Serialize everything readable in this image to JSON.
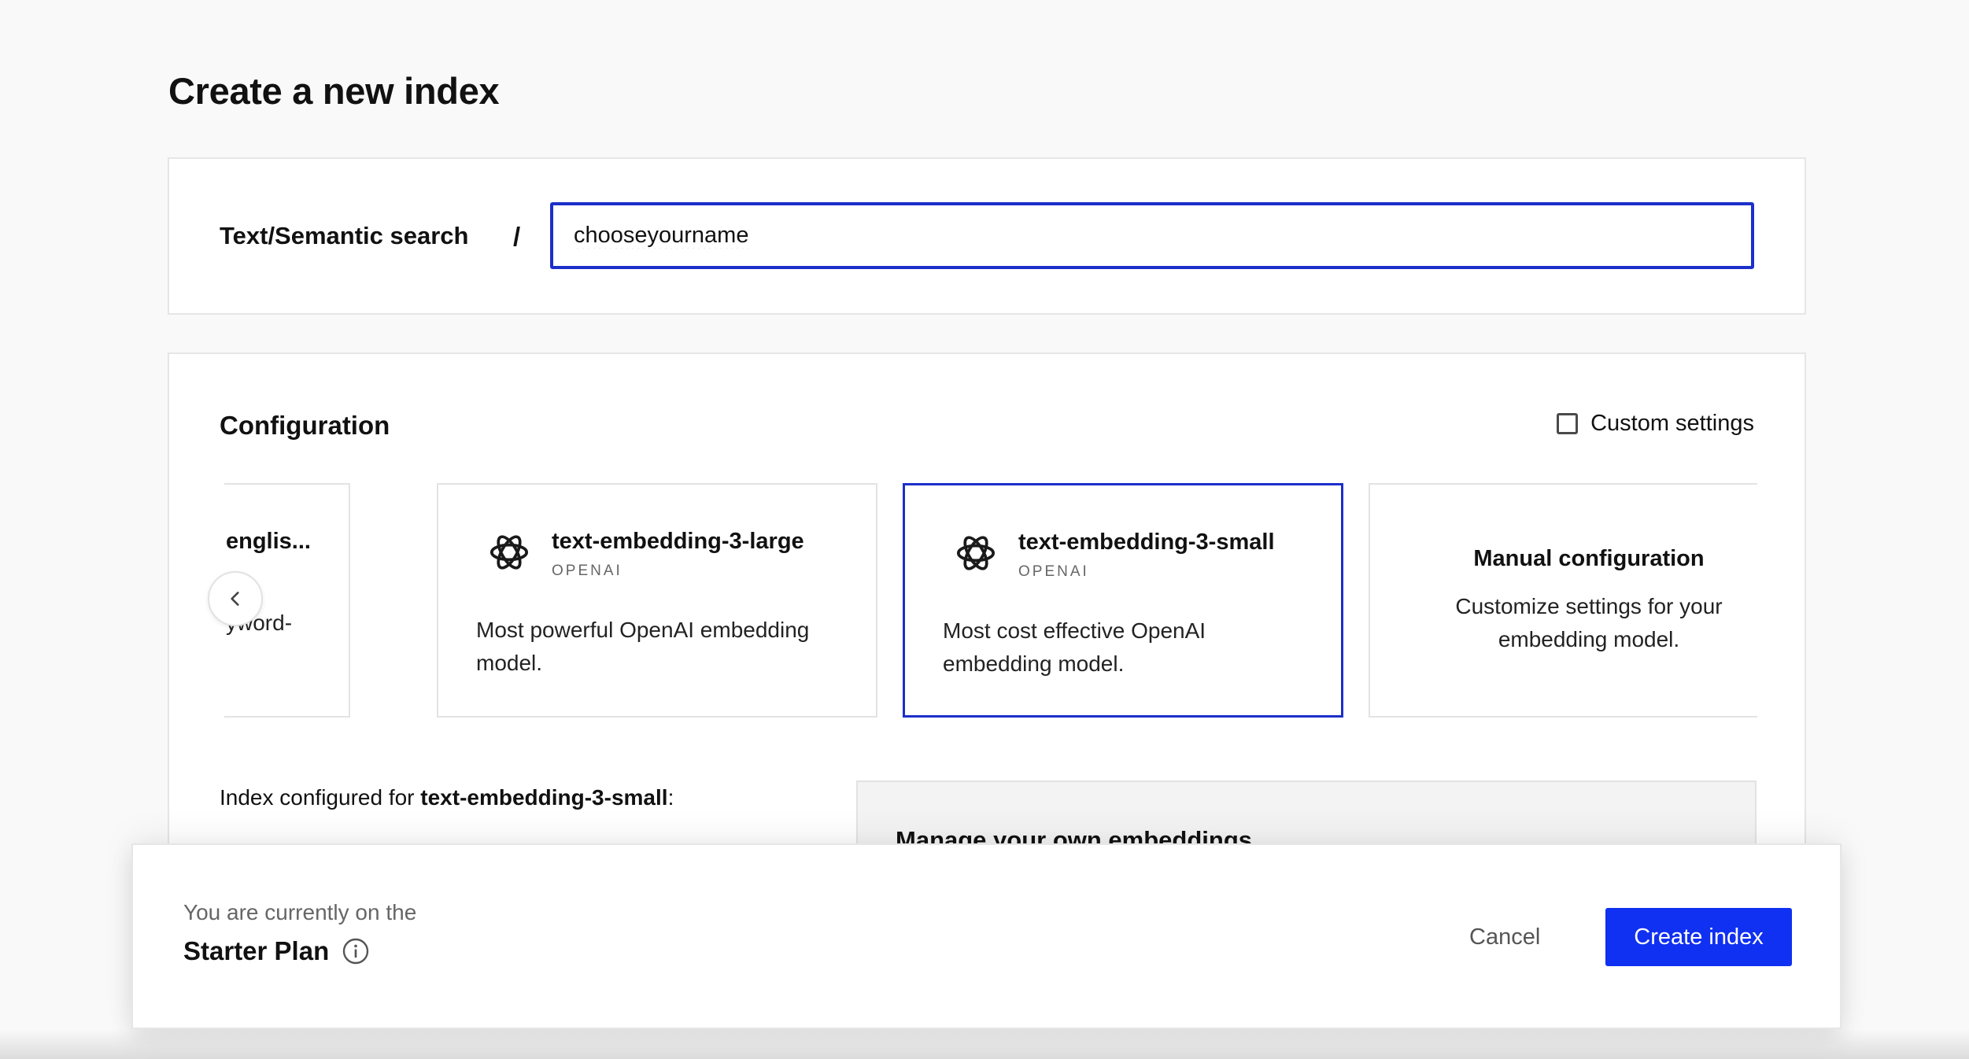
{
  "page": {
    "title": "Create a new index"
  },
  "name_section": {
    "label": "Text/Semantic search",
    "separator": "/",
    "input_value": "chooseyourname"
  },
  "configuration": {
    "title": "Configuration",
    "custom_settings_label": "Custom settings",
    "custom_settings_checked": false,
    "cards": {
      "partial": {
        "name": "englis...",
        "desc": "yword-"
      },
      "large": {
        "name": "text-embedding-3-large",
        "vendor": "OPENAI",
        "desc": "Most powerful OpenAI embedding model.",
        "icon": "openai-icon"
      },
      "small": {
        "name": "text-embedding-3-small",
        "vendor": "OPENAI",
        "desc": "Most cost effective OpenAI embedding model.",
        "icon": "openai-icon",
        "selected": true
      },
      "manual": {
        "name": "Manual configuration",
        "desc": "Customize settings for your embedding model."
      }
    },
    "index_configured_prefix": "Index configured for",
    "index_configured_model": "text-embedding-3-small",
    "index_configured_suffix": ":",
    "embeddings_box_title": "Manage your own embeddings"
  },
  "footer": {
    "plan_note": "You are currently on the",
    "plan_name": "Starter Plan",
    "cancel_label": "Cancel",
    "create_label": "Create index"
  },
  "colors": {
    "accent": "#1030f2",
    "selected_border": "#1b2fc9"
  }
}
